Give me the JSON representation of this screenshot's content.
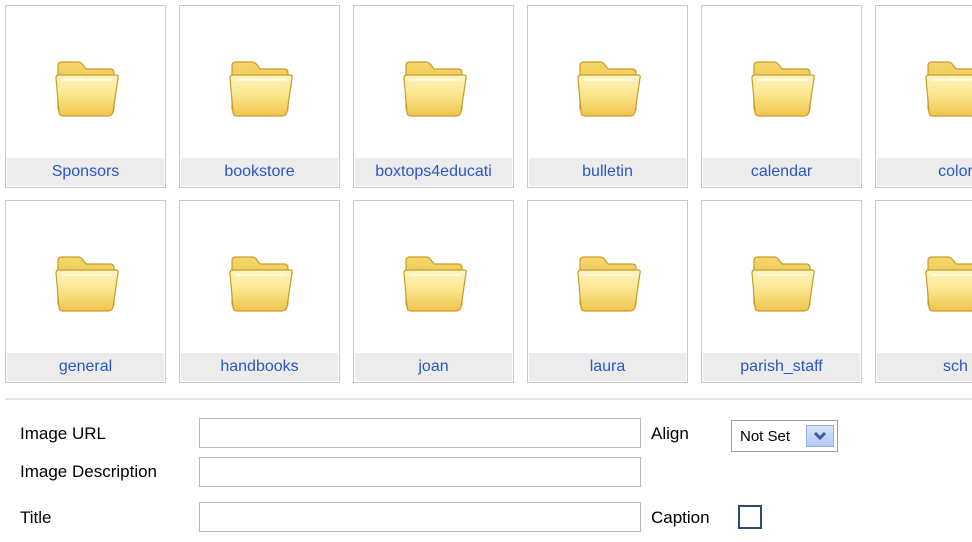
{
  "folders": [
    {
      "label": "Sponsors"
    },
    {
      "label": "bookstore"
    },
    {
      "label": "boxtops4educati"
    },
    {
      "label": "bulletin"
    },
    {
      "label": "calendar"
    },
    {
      "label": "color"
    },
    {
      "label": "general"
    },
    {
      "label": "handbooks"
    },
    {
      "label": "joan"
    },
    {
      "label": "laura"
    },
    {
      "label": "parish_staff"
    },
    {
      "label": "sch"
    }
  ],
  "form": {
    "image_url_label": "Image URL",
    "image_url_value": "",
    "image_description_label": "Image Description",
    "image_description_value": "",
    "title_label": "Title",
    "title_value": "",
    "align_label": "Align",
    "align_value": "Not Set",
    "caption_label": "Caption",
    "caption_checked": false
  },
  "icons": {
    "folder": "folder-icon",
    "dropdown": "chevron-down-icon"
  },
  "colors": {
    "label_link": "#2a56c6",
    "label_bg": "#ececec",
    "tile_border": "#c9c9c9",
    "select_arrow": "#98b0e6"
  }
}
